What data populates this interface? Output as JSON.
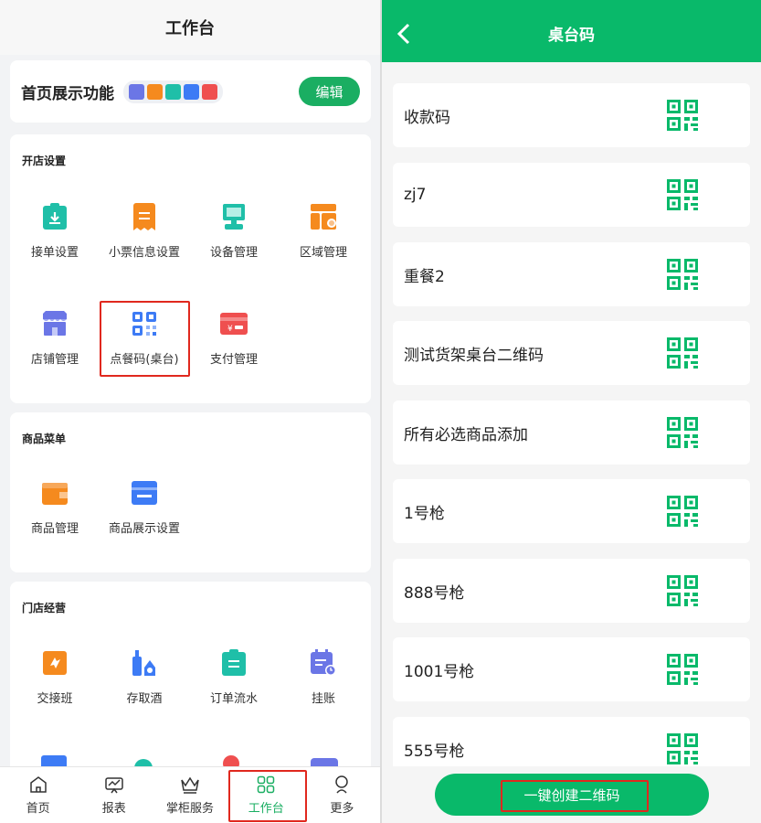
{
  "left": {
    "header_title": "工作台",
    "showcase": {
      "title": "首页展示功能",
      "edit_label": "编辑"
    },
    "sections": [
      {
        "title": "开店设置",
        "items": [
          "接单设置",
          "小票信息设置",
          "设备管理",
          "区域管理",
          "店铺管理",
          "点餐码(桌台)",
          "支付管理"
        ]
      },
      {
        "title": "商品菜单",
        "items": [
          "商品管理",
          "商品展示设置"
        ]
      },
      {
        "title": "门店经营",
        "items": [
          "交接班",
          "存取酒",
          "订单流水",
          "挂账"
        ]
      }
    ],
    "nav": [
      "首页",
      "报表",
      "掌柜服务",
      "工作台",
      "更多"
    ],
    "active_nav": "工作台"
  },
  "right": {
    "header_title": "桌台码",
    "qr_list": [
      "收款码",
      "zj7",
      "重餐2",
      "测试货架桌台二维码",
      "所有必选商品添加",
      "1号枪",
      "888号枪",
      "1001号枪",
      "555号枪"
    ],
    "create_label": "一键创建二维码"
  },
  "colors": {
    "brand_green": "#09b96a",
    "button_green": "#1aae62",
    "highlight_red": "#e0281e"
  }
}
